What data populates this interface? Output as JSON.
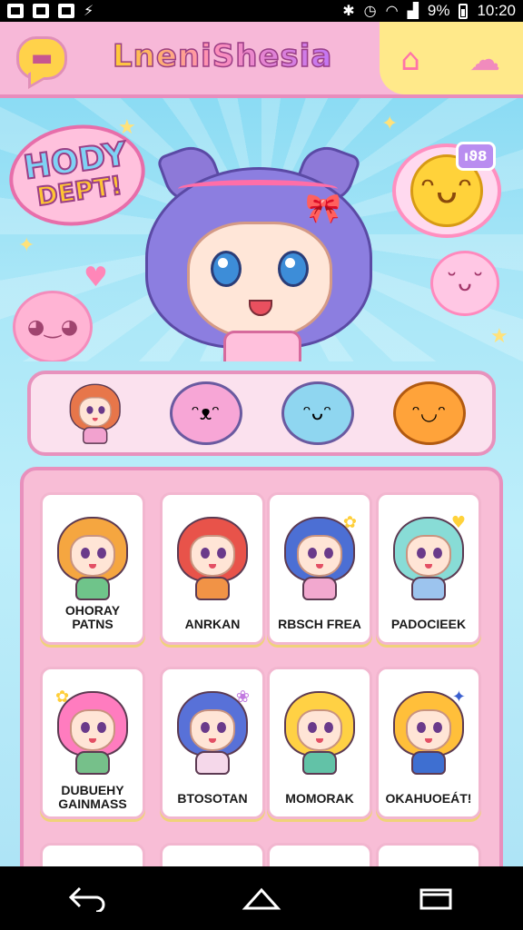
{
  "status_bar": {
    "time": "10:20",
    "battery": "9%",
    "left_icons": [
      "k-app-icon",
      "image-icon",
      "gallery-icon",
      "bolt-icon"
    ],
    "right_icons": [
      "bluetooth-icon",
      "alarm-icon",
      "wifi-icon",
      "signal-icon",
      "battery-icon"
    ]
  },
  "header": {
    "title": "LneniShesia",
    "menu_icon": "speech-bubble-icon",
    "home_icon": "home-icon",
    "cloud_icon": "cloud-icon",
    "colors": {
      "pink": "#f7b8d8",
      "yellow": "#ffe98a",
      "border": "#e88dbd"
    }
  },
  "hero": {
    "logo_line1": "HODY",
    "logo_line2": "DEPT!",
    "badge": "ıϑ8",
    "sky_color": "#7fd7f2"
  },
  "rail": {
    "items": [
      {
        "name": "rail-character-girl",
        "color": "#e7764a"
      },
      {
        "name": "rail-character-pink-blob",
        "color": "#f7a6d6"
      },
      {
        "name": "rail-character-blue-blob",
        "color": "#8fd6f0"
      },
      {
        "name": "rail-character-orange-cat",
        "color": "#ffa33a"
      }
    ]
  },
  "grid": {
    "cards": [
      {
        "label": "OHORAY PATNS",
        "hair": "#f5a640",
        "body": "#6fc48a"
      },
      {
        "label": "ANRKAN",
        "hair": "#e8534a",
        "body": "#f19346"
      },
      {
        "label": "RBSCH FREA",
        "hair": "#4c6fd4",
        "body": "#f2a8cf"
      },
      {
        "label": "PADOCIEEK",
        "hair": "#88dcd6",
        "body": "#9cc4ee"
      },
      {
        "label": "DUBUEHY GAINMASS",
        "hair": "#ff7cbf",
        "body": "#76c08a"
      },
      {
        "label": "BTOSOTAN",
        "hair": "#5871d8",
        "body": "#f5d8ea"
      },
      {
        "label": "MOMORAK",
        "hair": "#ffd144",
        "body": "#62c2a7"
      },
      {
        "label": "OKAHUOEÁT!",
        "hair": "#ffbf3a",
        "body": "#3e6fd1"
      }
    ],
    "partial_row": [
      {
        "hair": "#8a5a3a"
      },
      {
        "hair": "#f0a24a"
      },
      {
        "hair": "#ffcf44"
      },
      {
        "hair": "#3f5fbf"
      }
    ]
  },
  "nav": {
    "back_icon": "back-icon",
    "home_icon": "nav-home-icon",
    "recents_icon": "recents-icon"
  }
}
